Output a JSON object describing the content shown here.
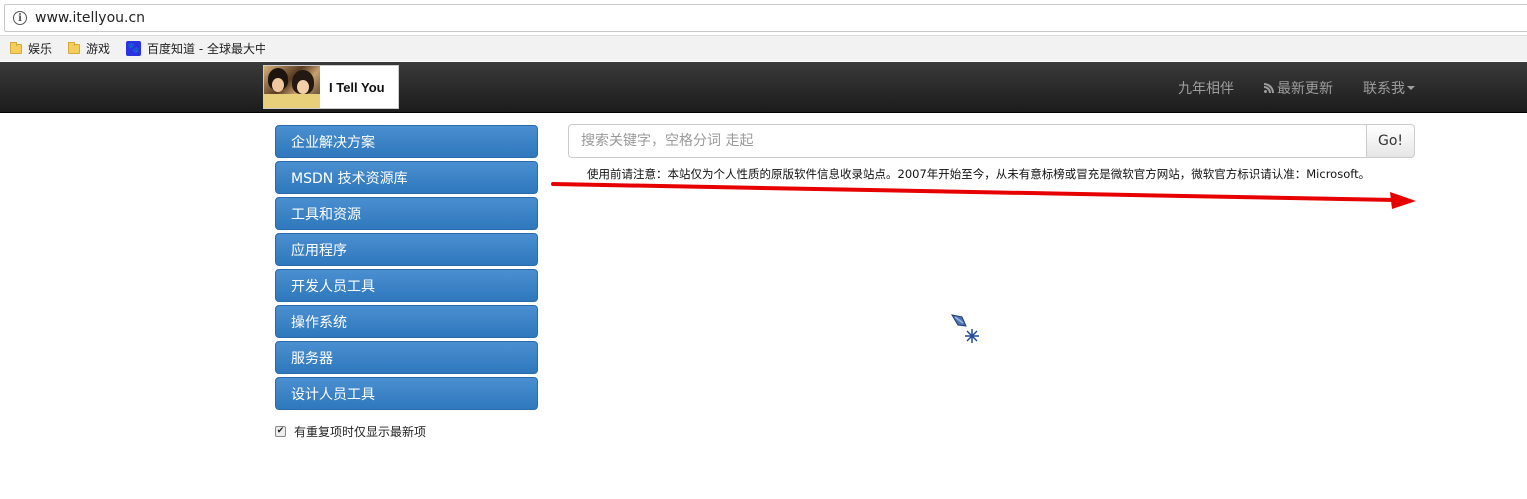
{
  "browser": {
    "url": "www.itellyou.cn",
    "bookmarks": [
      {
        "label": "娱乐",
        "icon": "folder-icon"
      },
      {
        "label": "游戏",
        "icon": "folder-icon"
      },
      {
        "label": "百度知道 - 全球最大中",
        "icon": "baidu-paw-icon"
      }
    ]
  },
  "navbar": {
    "brand_text": "I Tell You",
    "links": [
      "九年相伴",
      "最新更新",
      "联系我"
    ]
  },
  "sidebar": {
    "items": [
      {
        "label": "企业解决方案"
      },
      {
        "label": "MSDN 技术资源库"
      },
      {
        "label": "工具和资源"
      },
      {
        "label": "应用程序"
      },
      {
        "label": "开发人员工具"
      },
      {
        "label": "操作系统"
      },
      {
        "label": "服务器"
      },
      {
        "label": "设计人员工具"
      }
    ],
    "checkbox_label": "有重复项时仅显示最新项",
    "checkbox_checked": true
  },
  "search": {
    "placeholder": "搜索关键字，空格分词 走起",
    "button_label": "Go!"
  },
  "notice": "使用前请注意：本站仅为个人性质的原版软件信息收录站点。2007年开始至今，从未有意标榜或冒充是微软官方网站，微软官方标识请认准：Microsoft。",
  "colors": {
    "accent_blue": "#337ab7",
    "annotation_red": "#e60000",
    "navbar_dark": "#222222"
  }
}
